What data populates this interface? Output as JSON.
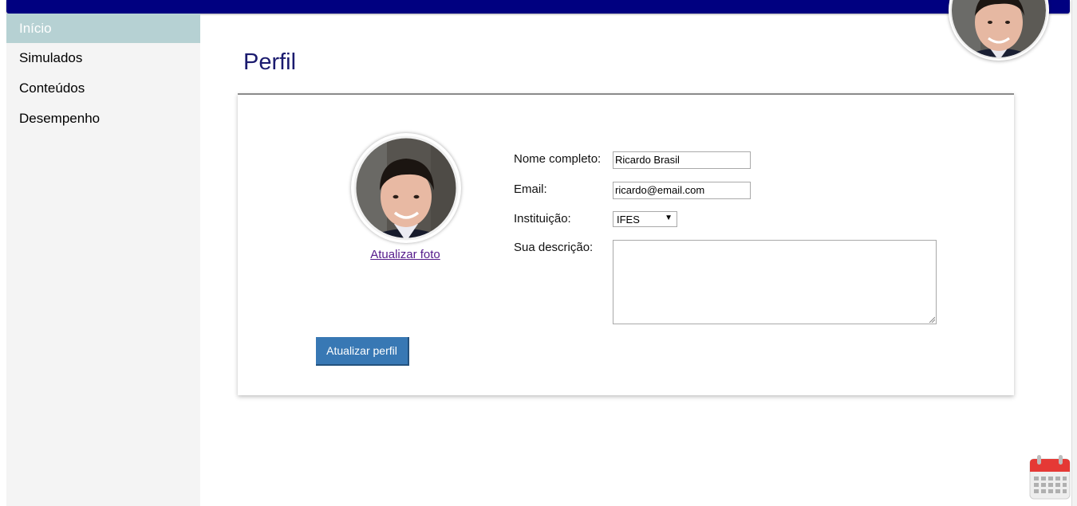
{
  "sidebar": {
    "items": [
      {
        "label": "Início",
        "active": true
      },
      {
        "label": "Simulados"
      },
      {
        "label": "Conteúdos"
      },
      {
        "label": "Desempenho"
      }
    ]
  },
  "page": {
    "title": "Perfil"
  },
  "profile": {
    "photo_link": "Atualizar foto",
    "fields": {
      "name_label": "Nome completo:",
      "name_value": "Ricardo Brasil",
      "email_label": "Email:",
      "email_value": "ricardo@email.com",
      "institution_label": "Instituição:",
      "institution_value": "IFES",
      "description_label": "Sua descrição:",
      "description_value": ""
    },
    "submit_label": "Atualizar perfil"
  },
  "colors": {
    "topbar": "#000080",
    "sidebar_active": "#b6d1d3",
    "title": "#1a1a6e",
    "button": "#3878b4",
    "link": "#551a8b"
  },
  "icons": {
    "calendar": "calendar-icon",
    "avatar": "user-avatar"
  }
}
